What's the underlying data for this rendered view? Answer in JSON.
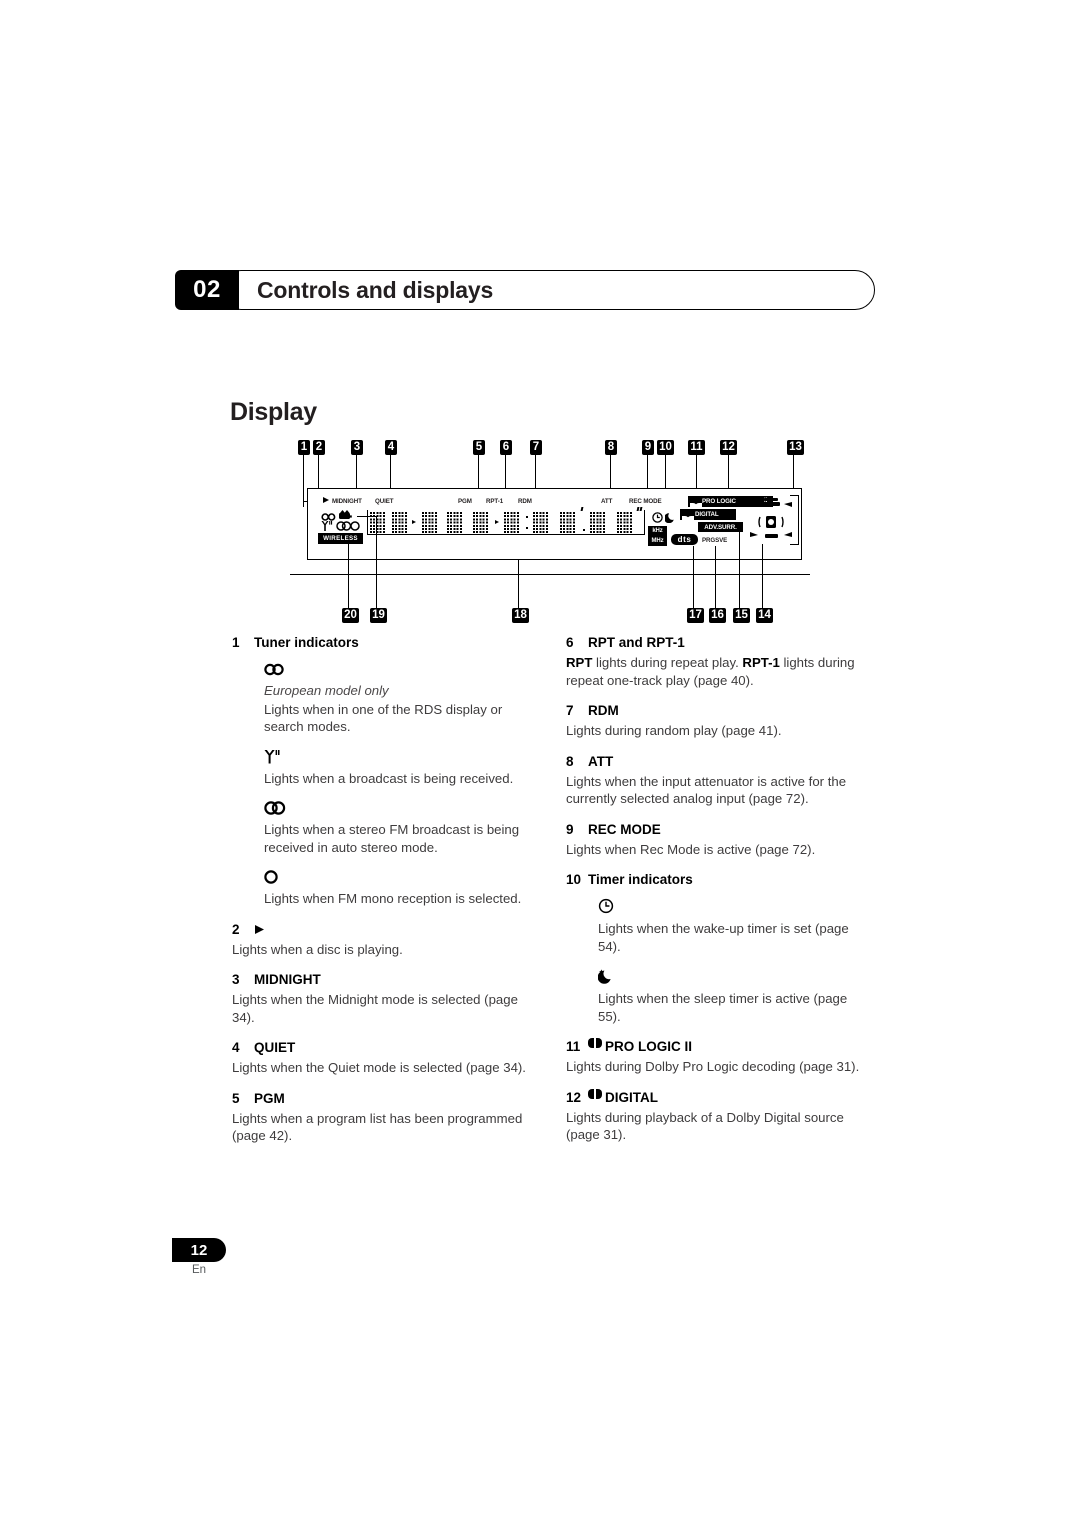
{
  "header": {
    "chapter_number": "02",
    "chapter_title": "Controls and displays"
  },
  "section": {
    "title": "Display"
  },
  "diagram": {
    "name": "front-panel-display-diagram",
    "callout_numbers_top": [
      "1",
      "2",
      "3",
      "4",
      "5",
      "6",
      "7",
      "8",
      "9",
      "10",
      "11",
      "12",
      "13"
    ],
    "callout_numbers_bottom": [
      "20",
      "19",
      "18",
      "17",
      "16",
      "15",
      "14"
    ],
    "panel_labels": {
      "midnight": "MIDNIGHT",
      "quiet": "QUIET",
      "pgm": "PGM",
      "rpt1": "RPT-1",
      "rdm": "RDM",
      "att": "ATT",
      "rec_mode": "REC MODE",
      "pro_logic": "PRO LOGIC",
      "pro_logic_suffix": "II",
      "digital": "DIGITAL",
      "adv_surr": "ADV.SURR.",
      "prgsve": "PRGSVE",
      "dts": "dts",
      "khz": "kHz",
      "mhz": "MHz",
      "wireless": "WIRELESS"
    }
  },
  "left_column": [
    {
      "num": "1",
      "title": "Tuner indicators",
      "body": "",
      "subitems": [
        {
          "glyph": "rds-icon",
          "italic": "European model only",
          "text": "Lights when in one of the RDS display or search modes."
        },
        {
          "glyph": "antenna-icon",
          "italic": "",
          "text": "Lights when a broadcast is being received."
        },
        {
          "glyph": "stereo-icon",
          "italic": "",
          "text": "Lights when a stereo FM broadcast is being received in auto stereo mode."
        },
        {
          "glyph": "mono-icon",
          "italic": "",
          "text": "Lights when FM mono reception is selected."
        }
      ]
    },
    {
      "num": "2",
      "title": "play-icon",
      "body": "Lights when a disc is playing.",
      "subitems": []
    },
    {
      "num": "3",
      "title": "MIDNIGHT",
      "body": "Lights when the Midnight mode is selected (page 34).",
      "subitems": []
    },
    {
      "num": "4",
      "title": "QUIET",
      "body": "Lights when the Quiet mode is selected (page 34).",
      "subitems": []
    },
    {
      "num": "5",
      "title": "PGM",
      "body": "Lights when a program list has been programmed (page 42).",
      "subitems": []
    }
  ],
  "right_column": [
    {
      "num": "6",
      "title": "RPT and RPT-1",
      "body_rich": [
        {
          "t": "RPT",
          "b": true
        },
        {
          "t": " lights during repeat play. ",
          "b": false
        },
        {
          "t": "RPT-1",
          "b": true
        },
        {
          "t": " lights during repeat one-track play (page 40).",
          "b": false
        }
      ],
      "subitems": []
    },
    {
      "num": "7",
      "title": "RDM",
      "body": "Lights during random play (page 41).",
      "subitems": []
    },
    {
      "num": "8",
      "title": "ATT",
      "body": "Lights when the input attenuator is active for the currently selected analog input (page 72).",
      "subitems": []
    },
    {
      "num": "9",
      "title": "REC MODE",
      "body": "Lights when Rec Mode is active (page 72).",
      "subitems": []
    },
    {
      "num": "10",
      "title": "Timer indicators",
      "body": "",
      "subitems": [
        {
          "glyph": "clock-icon",
          "italic": "",
          "text": "Lights when the wake-up timer is set (page 54)."
        },
        {
          "glyph": "moon-icon",
          "italic": "",
          "text": "Lights when the sleep timer is active (page 55)."
        }
      ]
    },
    {
      "num": "11",
      "title": "PRO LOGIC II",
      "title_prefix_icon": "dolby-double-d-icon",
      "body": "Lights during Dolby Pro Logic decoding (page 31).",
      "subitems": []
    },
    {
      "num": "12",
      "title": "DIGITAL",
      "title_prefix_icon": "dolby-double-d-icon",
      "body": "Lights during playback of a Dolby Digital source (page 31).",
      "subitems": []
    }
  ],
  "footer": {
    "page_number": "12",
    "language": "En"
  }
}
